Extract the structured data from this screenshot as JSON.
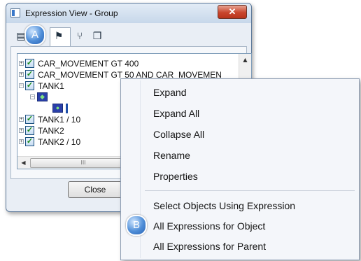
{
  "window": {
    "title": "Expression View - Group",
    "close_glyph": "✕",
    "close_button_label": "Close"
  },
  "markers": {
    "a": "A",
    "b": "B"
  },
  "toolbar": {
    "icons": [
      "properties-icon",
      "object-tree-icon",
      "hierarchy-icon",
      "copy-icon"
    ]
  },
  "tree": {
    "rows": [
      {
        "label": "CAR_MOVEMENT GT 400",
        "checked": true
      },
      {
        "label": "CAR_MOVEMENT GT 50 AND CAR_MOVEMEN",
        "checked": true
      },
      {
        "label": "TANK1",
        "checked": true
      },
      {
        "label": "",
        "checked": false
      },
      {
        "label": "",
        "checked": false
      },
      {
        "label": "TANK1 / 10",
        "checked": true
      },
      {
        "label": "TANK2",
        "checked": true
      },
      {
        "label": "TANK2 / 10",
        "checked": true
      }
    ],
    "hscroll_grip": "III"
  },
  "context_menu": {
    "items": [
      "Expand",
      "Expand All",
      "Collapse All",
      "Rename",
      "Properties"
    ],
    "items_after_separator": [
      "Select Objects Using Expression",
      "All Expressions for Object",
      "All Expressions for Parent"
    ]
  },
  "colors": {
    "marker_blue": "#4f8ed8",
    "close_red": "#c9462d",
    "window_border": "#5e7a9b"
  }
}
